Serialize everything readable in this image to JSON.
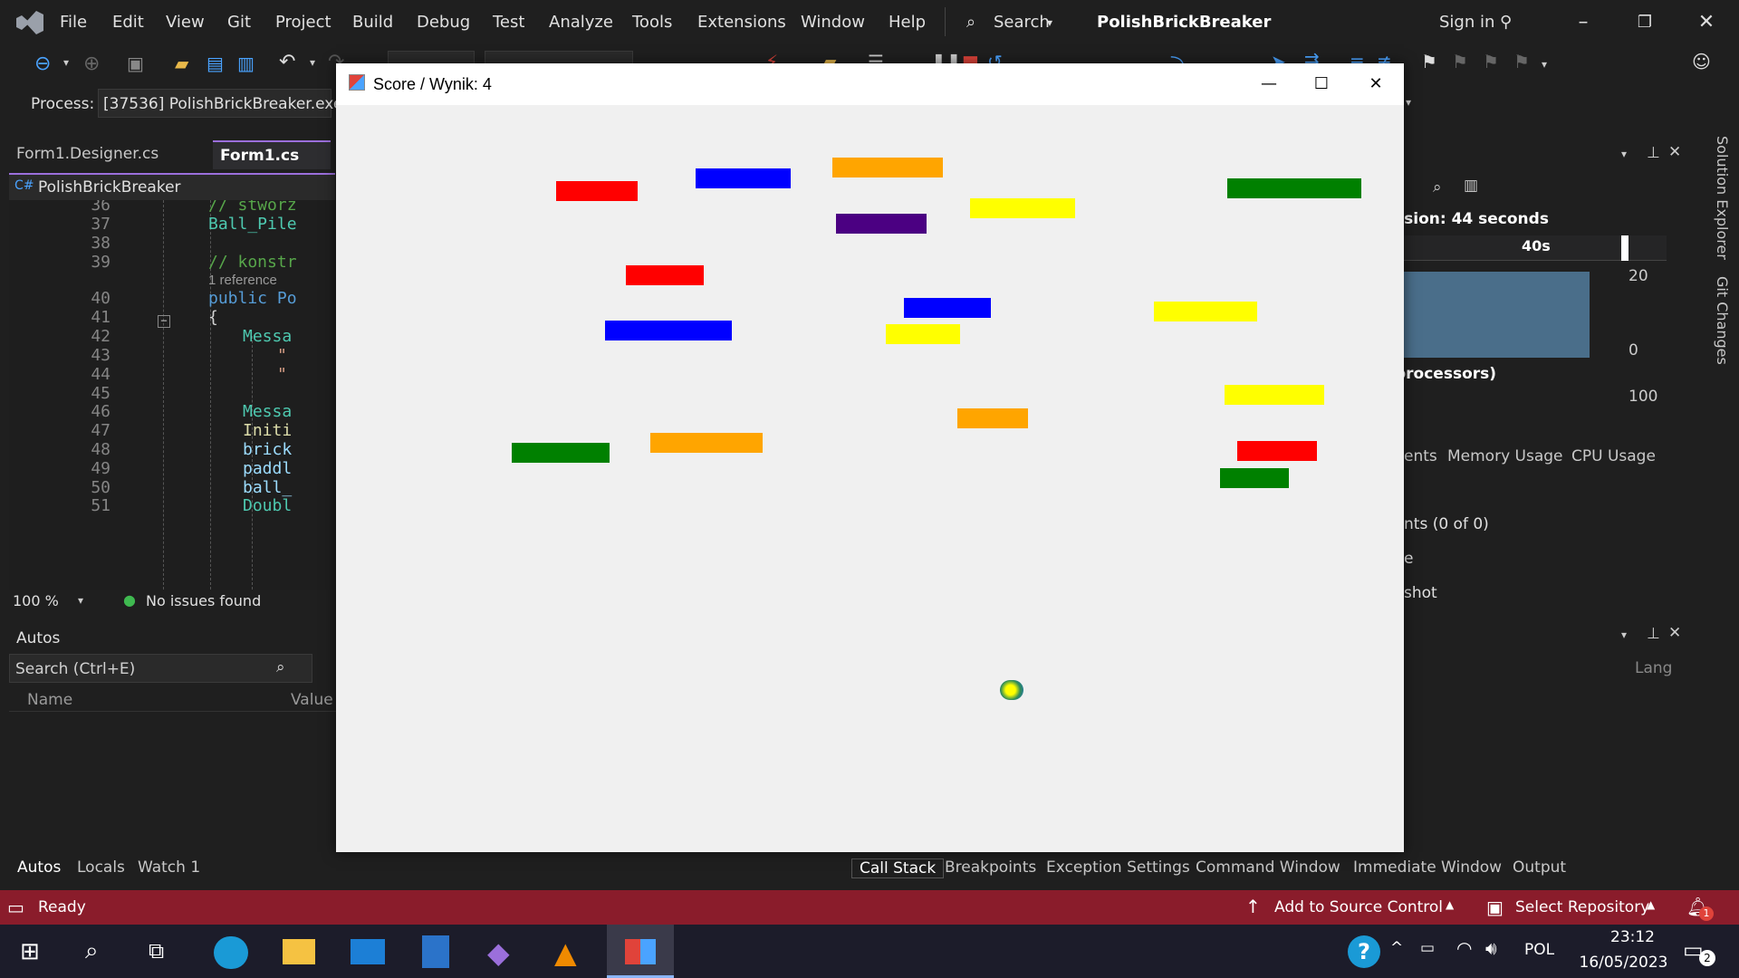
{
  "menu": {
    "items": [
      "File",
      "Edit",
      "View",
      "Git",
      "Project",
      "Build",
      "Debug",
      "Test",
      "Analyze",
      "Tools",
      "Extensions",
      "Window",
      "Help"
    ],
    "search_label": "Search",
    "solution_name": "PolishBrickBreaker",
    "sign_in": "Sign in"
  },
  "process": {
    "label": "Process:",
    "value": "[37536] PolishBrickBreaker.exe"
  },
  "editor": {
    "tabs": [
      "Form1.Designer.cs",
      "Form1.cs"
    ],
    "project_label": "PolishBrickBreaker",
    "line_numbers": [
      "36",
      "37",
      "38",
      "39",
      "",
      "40",
      "41",
      "42",
      "43",
      "44",
      "45",
      "46",
      "47",
      "48",
      "49",
      "50",
      "51"
    ],
    "lines": [
      "// stworz",
      "Ball_Pile",
      "",
      "// konstr",
      "1 reference",
      "public Po",
      "{",
      "Messa",
      "\"",
      "\"",
      "",
      "Messa",
      "Initi",
      "brick",
      "paddl",
      "ball_",
      "Doubl"
    ],
    "zoom": "100 %",
    "issues": "No issues found"
  },
  "autos": {
    "title": "Autos",
    "search_placeholder": "Search (Ctrl+E)",
    "col_name": "Name",
    "col_value": "Value",
    "tabs": [
      "Autos",
      "Locals",
      "Watch 1"
    ]
  },
  "bottom_tabs": [
    "Call Stack",
    "Breakpoints",
    "Exception Settings",
    "Command Window",
    "Immediate Window",
    "Output"
  ],
  "diagnostics": {
    "session": "ssion: 44 seconds",
    "time_marker": "40s",
    "max_value": "20",
    "min_value": "0",
    "processors": "processors)",
    "cpu_max": "100",
    "tabs": [
      "ents",
      "Memory Usage",
      "CPU Usage"
    ],
    "events": "nts (0 of 0)",
    "row_e": "e",
    "snapshot": "shot",
    "lang_col": "Lang"
  },
  "side_tabs": [
    "Solution Explorer",
    "Git Changes"
  ],
  "status": {
    "ready": "Ready",
    "source_control": "Add to Source Control",
    "repository": "Select Repository",
    "notifications": "1"
  },
  "taskbar": {
    "language": "POL",
    "time": "23:12",
    "date": "16/05/2023",
    "notif_count": "2"
  },
  "game": {
    "title": "Score / Wynik: 4",
    "bricks": [
      {
        "color": "#ff0000"
      },
      {
        "color": "#0000ff"
      },
      {
        "color": "#ffa500"
      },
      {
        "color": "#4b0082"
      },
      {
        "color": "#ffff00"
      },
      {
        "color": "#008000"
      },
      {
        "color": "#ff0000"
      },
      {
        "color": "#0000ff"
      },
      {
        "color": "#0000ff"
      },
      {
        "color": "#ffff00"
      },
      {
        "color": "#ffff00"
      },
      {
        "color": "#ffff00"
      },
      {
        "color": "#ffa500"
      },
      {
        "color": "#ffa500"
      },
      {
        "color": "#008000"
      },
      {
        "color": "#ff0000"
      },
      {
        "color": "#008000"
      }
    ],
    "paddle_color": "#9400d3",
    "ball_colors": [
      "#2e8b57",
      "#ffff00"
    ]
  },
  "colors": {
    "accent": "#9b6fdb",
    "statusbar": "#8a1c2b"
  }
}
